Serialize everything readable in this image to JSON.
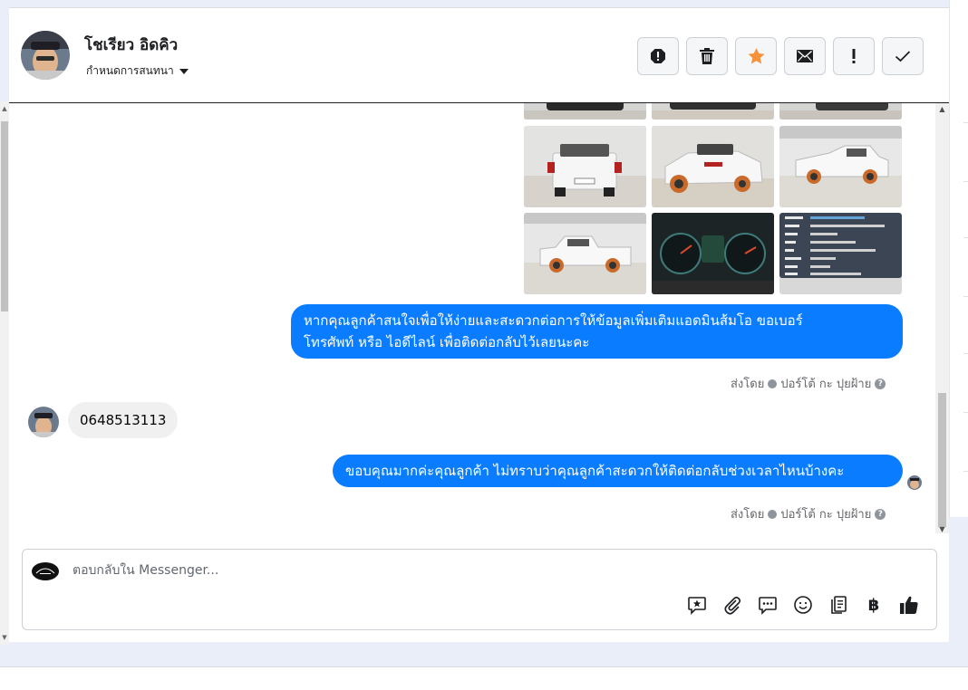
{
  "header": {
    "contact_name": "โชเรียว อิดคิว",
    "assign_label": "กำหนดการสนทนา",
    "actions": [
      {
        "name": "spam-button",
        "icon": "octagon-exclamation-icon"
      },
      {
        "name": "delete-button",
        "icon": "trash-icon"
      },
      {
        "name": "star-button",
        "icon": "star-icon"
      },
      {
        "name": "mark-unread-button",
        "icon": "envelope-icon"
      },
      {
        "name": "follow-up-button",
        "icon": "exclamation-icon"
      },
      {
        "name": "mark-done-button",
        "icon": "check-icon"
      }
    ]
  },
  "thread": {
    "messages": [
      {
        "from": "page",
        "text_lines": [
          "หากคุณลูกค้าสนใจเพื่อให้ง่ายและสะดวกต่อการให้ข้อมูลเพิ่มเติมแอดมินส้มโอ ขอเบอร์",
          "โทรศัพท์ หรือ ไอดีไลน์ เพื่อติดต่อกลับไว้เลยนะคะ"
        ]
      },
      {
        "from": "contact",
        "text": "0648513113"
      },
      {
        "from": "page",
        "text": "ขอบคุณมากค่ะคุณลูกค้า ไม่ทราบว่าคุณลูกค้าสะดวกให้ติดต่อกลับช่วงเวลาไหนบ้างคะ"
      }
    ],
    "sent_by_label": "ส่งโดย",
    "sender_name": "ปอร์โต้ กะ ปุยฝ้าย",
    "help_glyph": "?"
  },
  "composer": {
    "placeholder": "ตอบกลับใน Messenger...",
    "currency_glyph": "฿"
  },
  "colors": {
    "accent": "#0a7cff",
    "star": "#f7923a",
    "incoming_bubble": "#f0f0f0"
  }
}
